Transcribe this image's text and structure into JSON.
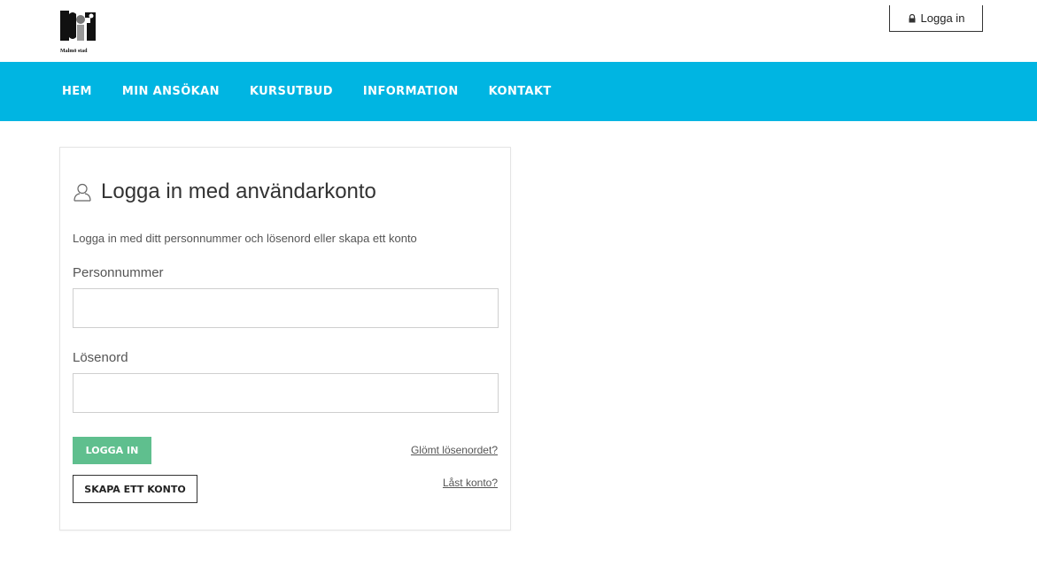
{
  "header": {
    "logo_text": "Malmö stad",
    "login_label": "Logga in",
    "login_icon": "lock-icon"
  },
  "nav": {
    "items": [
      {
        "label": "HEM"
      },
      {
        "label": "MIN ANSÖKAN"
      },
      {
        "label": "KURSUTBUD"
      },
      {
        "label": "INFORMATION"
      },
      {
        "label": "KONTAKT"
      }
    ],
    "background_color": "#00b5e2"
  },
  "login_card": {
    "title": "Logga in med användarkonto",
    "title_icon": "user-icon",
    "intro": "Logga in med ditt personnummer och lösenord eller skapa ett konto",
    "personnummer_label": "Personnummer",
    "personnummer_value": "",
    "password_label": "Lösenord",
    "password_value": "",
    "login_button": "LOGGA IN",
    "login_button_color": "#5fbf8e",
    "create_account_button": "SKAPA ETT KONTO",
    "forgot_password_link": "Glömt lösenordet?",
    "locked_account_link": "Låst konto?"
  }
}
